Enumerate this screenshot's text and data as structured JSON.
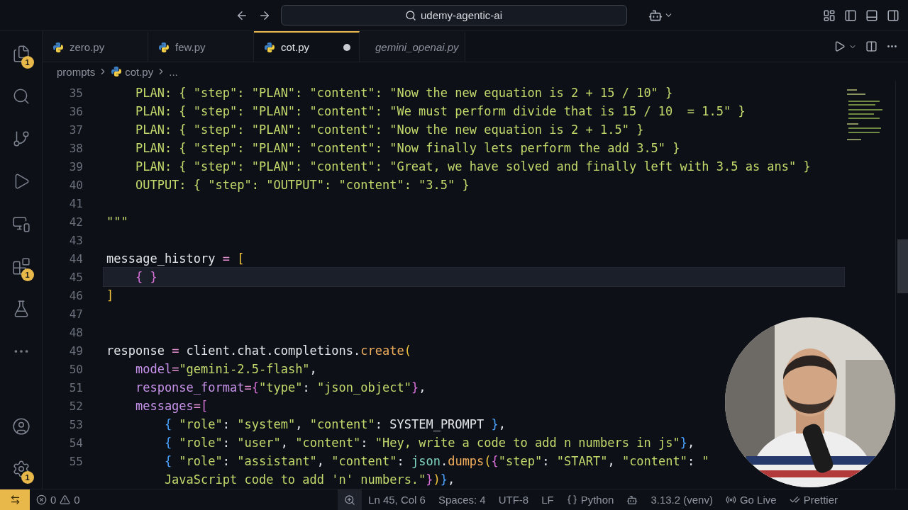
{
  "title_bar": {
    "search": "udemy-agentic-ai"
  },
  "activity_bar": {
    "top": [
      {
        "kind": "explorer",
        "badge": "1"
      },
      {
        "kind": "search"
      },
      {
        "kind": "source-control"
      },
      {
        "kind": "run"
      },
      {
        "kind": "remote"
      },
      {
        "kind": "extensions",
        "badge": "1"
      },
      {
        "kind": "testing"
      },
      {
        "kind": "more"
      }
    ],
    "bottom": [
      {
        "kind": "account"
      },
      {
        "kind": "settings",
        "badge": "1"
      }
    ]
  },
  "tabs": [
    {
      "label": "zero.py",
      "selected": false,
      "modified": false,
      "preview": false
    },
    {
      "label": "few.py",
      "selected": false,
      "modified": false,
      "preview": false
    },
    {
      "label": "cot.py",
      "selected": true,
      "modified": true,
      "preview": false
    },
    {
      "label": "gemini_openai.py",
      "selected": false,
      "modified": false,
      "preview": true
    }
  ],
  "breadcrumb": {
    "folder": "prompts",
    "file": "cot.py",
    "tail": "..."
  },
  "lines": [
    {
      "number": "35",
      "current": false,
      "tokens": [
        {
          "text": "    PLAN: { \"step\": \"PLAN\": \"content\": \"Now the new equation is 2 + 15 / 10\" }",
          "kind": "str"
        }
      ]
    },
    {
      "number": "36",
      "current": false,
      "tokens": [
        {
          "text": "    PLAN: { \"step\": \"PLAN\": \"content\": \"We must perform divide that is 15 / 10  = 1.5\" }",
          "kind": "str"
        }
      ]
    },
    {
      "number": "37",
      "current": false,
      "tokens": [
        {
          "text": "    PLAN: { \"step\": \"PLAN\": \"content\": \"Now the new equation is 2 + 1.5\" }",
          "kind": "str"
        }
      ]
    },
    {
      "number": "38",
      "current": false,
      "tokens": [
        {
          "text": "    PLAN: { \"step\": \"PLAN\": \"content\": \"Now finally lets perform the add 3.5\" }",
          "kind": "str"
        }
      ]
    },
    {
      "number": "39",
      "current": false,
      "tokens": [
        {
          "text": "    PLAN: { \"step\": \"PLAN\": \"content\": \"Great, we have solved and finally left with 3.5 as ans\" }",
          "kind": "str"
        }
      ]
    },
    {
      "number": "40",
      "current": false,
      "tokens": [
        {
          "text": "    OUTPUT: { \"step\": \"OUTPUT\": \"content\": \"3.5\" }",
          "kind": "str"
        }
      ]
    },
    {
      "number": "41",
      "current": false
    },
    {
      "number": "42",
      "current": false,
      "tokens": [
        {
          "text": "\"\"\"",
          "kind": "str"
        }
      ]
    },
    {
      "number": "43",
      "current": false
    },
    {
      "number": "44",
      "current": false,
      "tokens": [
        {
          "text": "message_history ",
          "kind": "plain"
        },
        {
          "text": "= ",
          "kind": "op"
        },
        {
          "text": "[",
          "kind": "b1"
        }
      ]
    },
    {
      "number": "45",
      "current": true,
      "tokens": [
        {
          "text": "    { }",
          "kind": "b2"
        }
      ]
    },
    {
      "number": "46",
      "current": false,
      "tokens": [
        {
          "text": "]",
          "kind": "b1"
        }
      ]
    },
    {
      "number": "47",
      "current": false
    },
    {
      "number": "48",
      "current": false
    },
    {
      "number": "49",
      "current": false,
      "tokens": [
        {
          "text": "response ",
          "kind": "plain"
        },
        {
          "text": "= ",
          "kind": "op"
        },
        {
          "text": "client.chat.completions.",
          "kind": "plain"
        },
        {
          "text": "create",
          "kind": "func"
        },
        {
          "text": "(",
          "kind": "b1"
        }
      ]
    },
    {
      "number": "50",
      "current": false,
      "tokens": [
        {
          "text": "    model",
          "kind": "param"
        },
        {
          "text": "=",
          "kind": "op"
        },
        {
          "text": "\"gemini-2.5-flash\"",
          "kind": "str"
        },
        {
          "text": ",",
          "kind": "plain"
        }
      ]
    },
    {
      "number": "51",
      "current": false,
      "tokens": [
        {
          "text": "    response_format",
          "kind": "param"
        },
        {
          "text": "=",
          "kind": "op"
        },
        {
          "text": "{",
          "kind": "b2"
        },
        {
          "text": "\"type\"",
          "kind": "str"
        },
        {
          "text": ": ",
          "kind": "plain"
        },
        {
          "text": "\"json_object\"",
          "kind": "str"
        },
        {
          "text": "}",
          "kind": "b2"
        },
        {
          "text": ",",
          "kind": "plain"
        }
      ]
    },
    {
      "number": "52",
      "current": false,
      "tokens": [
        {
          "text": "    messages",
          "kind": "param"
        },
        {
          "text": "=",
          "kind": "op"
        },
        {
          "text": "[",
          "kind": "b2"
        }
      ]
    },
    {
      "number": "53",
      "current": false,
      "tokens": [
        {
          "text": "        {",
          "kind": "b3"
        },
        {
          "text": " \"role\"",
          "kind": "str"
        },
        {
          "text": ": ",
          "kind": "plain"
        },
        {
          "text": "\"system\"",
          "kind": "str"
        },
        {
          "text": ", ",
          "kind": "plain"
        },
        {
          "text": "\"content\"",
          "kind": "str"
        },
        {
          "text": ": SYSTEM_PROMPT ",
          "kind": "plain"
        },
        {
          "text": "}",
          "kind": "b3"
        },
        {
          "text": ",",
          "kind": "plain"
        }
      ]
    },
    {
      "number": "54",
      "current": false,
      "tokens": [
        {
          "text": "        {",
          "kind": "b3"
        },
        {
          "text": " \"role\"",
          "kind": "str"
        },
        {
          "text": ": ",
          "kind": "plain"
        },
        {
          "text": "\"user\"",
          "kind": "str"
        },
        {
          "text": ", ",
          "kind": "plain"
        },
        {
          "text": "\"content\"",
          "kind": "str"
        },
        {
          "text": ": ",
          "kind": "plain"
        },
        {
          "text": "\"Hey, write a code to add n numbers in js\"",
          "kind": "str"
        },
        {
          "text": "}",
          "kind": "b3"
        },
        {
          "text": ",",
          "kind": "plain"
        }
      ]
    },
    {
      "number": "55",
      "current": false,
      "tokens": [
        {
          "text": "        {",
          "kind": "b3"
        },
        {
          "text": " \"role\"",
          "kind": "str"
        },
        {
          "text": ": ",
          "kind": "plain"
        },
        {
          "text": "\"assistant\"",
          "kind": "str"
        },
        {
          "text": ", ",
          "kind": "plain"
        },
        {
          "text": "\"content\"",
          "kind": "str"
        },
        {
          "text": ": ",
          "kind": "plain"
        },
        {
          "text": "json",
          "kind": "module"
        },
        {
          "text": ".",
          "kind": "plain"
        },
        {
          "text": "dumps",
          "kind": "func"
        },
        {
          "text": "(",
          "kind": "b1"
        },
        {
          "text": "{",
          "kind": "b2"
        },
        {
          "text": "\"step\"",
          "kind": "str"
        },
        {
          "text": ": ",
          "kind": "plain"
        },
        {
          "text": "\"START\"",
          "kind": "str"
        },
        {
          "text": ", ",
          "kind": "plain"
        },
        {
          "text": "\"content\"",
          "kind": "str"
        },
        {
          "text": ": ",
          "kind": "plain"
        },
        {
          "text": "\"",
          "kind": "str"
        }
      ]
    },
    {
      "current": false,
      "tokens": [
        {
          "text": "        JavaScript code to add 'n' numbers.\"",
          "kind": "str"
        },
        {
          "text": "}",
          "kind": "b2"
        },
        {
          "text": ")",
          "kind": "b1"
        },
        {
          "text": "}",
          "kind": "b3"
        },
        {
          "text": ",",
          "kind": "plain"
        }
      ]
    }
  ],
  "status_bar": {
    "errors": "0",
    "warnings": "0",
    "right": [
      {
        "kind": "zoom"
      },
      {
        "kind": "text",
        "text": "Ln 45, Col 6"
      },
      {
        "kind": "text",
        "text": "Spaces: 4"
      },
      {
        "kind": "text",
        "text": "UTF-8"
      },
      {
        "kind": "text",
        "text": "LF"
      },
      {
        "kind": "language",
        "text": "Python"
      },
      {
        "kind": "copilot"
      },
      {
        "kind": "text",
        "text": "3.13.2 (venv)"
      },
      {
        "kind": "live",
        "text": "Go Live"
      },
      {
        "kind": "prettier",
        "text": "Prettier"
      }
    ]
  }
}
